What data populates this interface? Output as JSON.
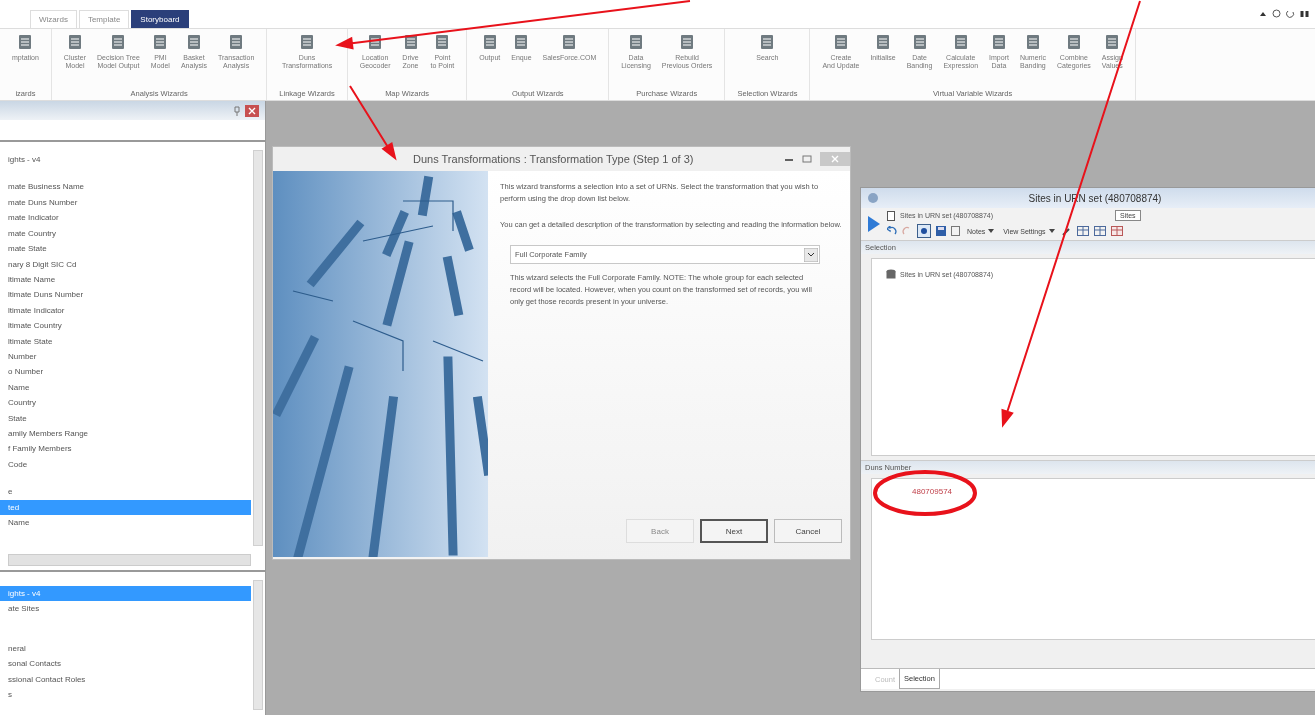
{
  "ribbon_tabs": [
    {
      "label": "Wizards",
      "selected": false
    },
    {
      "label": "Template",
      "selected": false
    },
    {
      "label": "Storyboard",
      "selected": true
    }
  ],
  "ribbon_groups": [
    {
      "label": "izards",
      "buttons": [
        "mptation"
      ]
    },
    {
      "label": "Analysis Wizards",
      "buttons": [
        "Cluster\nModel",
        "Decision Tree\nModel Output",
        "PMI\nModel",
        "Basket\nAnalysis",
        "Transaction\nAnalysis"
      ]
    },
    {
      "label": "Linkage Wizards",
      "buttons": [
        "Duns\nTransformations"
      ]
    },
    {
      "label": "Map Wizards",
      "buttons": [
        "Location\nGeocoder",
        "Drive\nZone",
        "Point\nto Point"
      ]
    },
    {
      "label": "Output Wizards",
      "buttons": [
        "Output",
        "Enque",
        "SalesForce.COM"
      ]
    },
    {
      "label": "Purchase Wizards",
      "buttons": [
        "Data\nLicensing",
        "Rebuild\nPrevious Orders"
      ]
    },
    {
      "label": "Selection Wizards",
      "buttons": [
        "Search"
      ]
    },
    {
      "label": "Virtual Variable Wizards",
      "buttons": [
        "Create\nAnd Update",
        "Initialise",
        "Date\nBanding",
        "Calculate\nExpression",
        "Import\nData",
        "Numeric\nBanding",
        "Combine\nCategories",
        "Assign\nValues"
      ]
    }
  ],
  "upper_list": [
    [
      {
        "label": "ights - v4",
        "selected": false
      }
    ],
    [
      {
        "label": "mate Business Name",
        "selected": false
      },
      {
        "label": "mate Duns Number",
        "selected": false
      },
      {
        "label": "mate Indicator",
        "selected": false
      },
      {
        "label": "mate Country",
        "selected": false
      },
      {
        "label": "mate State",
        "selected": false
      },
      {
        "label": "nary 8 Digit SIC Cd",
        "selected": false
      },
      {
        "label": "ltimate Name",
        "selected": false
      },
      {
        "label": "ltimate Duns Number",
        "selected": false
      },
      {
        "label": "ltimate Indicator",
        "selected": false
      },
      {
        "label": "ltimate Country",
        "selected": false
      },
      {
        "label": "ltimate State",
        "selected": false
      },
      {
        "label": "Number",
        "selected": false
      },
      {
        "label": "o Number",
        "selected": false
      },
      {
        "label": "Name",
        "selected": false
      },
      {
        "label": "Country",
        "selected": false
      },
      {
        "label": "State",
        "selected": false
      },
      {
        "label": "amily Members Range",
        "selected": false
      },
      {
        "label": "f Family Members",
        "selected": false
      },
      {
        "label": "Code",
        "selected": false
      }
    ],
    [
      {
        "label": "e",
        "selected": false
      },
      {
        "label": "ted",
        "selected": true
      },
      {
        "label": "Name",
        "selected": false
      }
    ]
  ],
  "lower_list": [
    [
      {
        "label": "ights - v4",
        "selected": true
      },
      {
        "label": "ate Sites",
        "selected": false
      }
    ],
    [
      {
        "label": "neral",
        "selected": false
      },
      {
        "label": "sonal Contacts",
        "selected": false
      },
      {
        "label": "ssional Contact Roles",
        "selected": false
      },
      {
        "label": "s",
        "selected": false
      }
    ]
  ],
  "dialog": {
    "title": "Duns Transformations : Transformation Type (Step 1 of 3)",
    "paragraphs": [
      "This wizard transforms a selection into a set of URNs. Select the transformation that you wish to perform using the drop down list below.",
      "You can get a detailed description of the transformation by selecting and reading the information below."
    ],
    "dropdown_value": "Full Corporate Family",
    "description": "This wizard selects the Full Corporate Family. NOTE: The whole group for each selected record will be located. However, when you count on the transformed set of records, you will only get those records present in your universe.",
    "buttons": [
      {
        "label": "Back",
        "disabled": true,
        "default": false
      },
      {
        "label": "Next",
        "disabled": false,
        "default": true
      },
      {
        "label": "Cancel",
        "disabled": false,
        "default": false
      }
    ]
  },
  "results_window": {
    "title": "Sites in URN set (480708874)",
    "breadcrumb": "Sites in URN set (480708874)",
    "view_field": "Sites",
    "toolbar": [
      "Notes",
      "View Settings"
    ],
    "selection_header": "Selection",
    "selection_item": "Sites in URN set (480708874)",
    "duns_header": "Duns Number",
    "duns_value": "480709574",
    "tabs": [
      {
        "label": "Count",
        "selected": false
      },
      {
        "label": "Selection",
        "selected": true
      }
    ]
  }
}
